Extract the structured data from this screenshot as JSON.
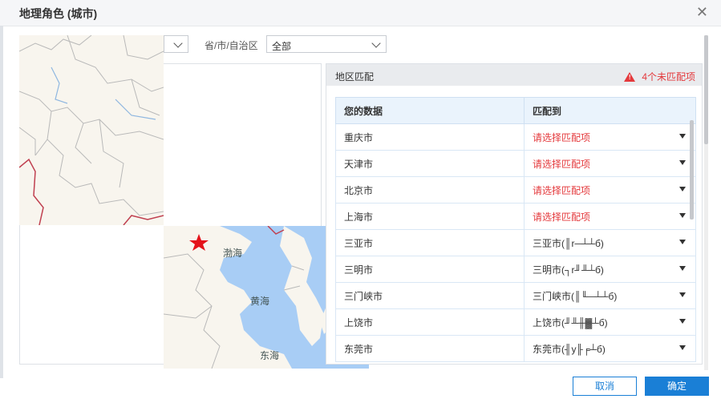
{
  "dialog": {
    "title": "地理角色 (城市)"
  },
  "filters": {
    "province_label": "省/市/自治区",
    "province_value": "全部"
  },
  "map": {
    "seas": [
      "渤海",
      "黄海",
      "东海"
    ]
  },
  "match_panel": {
    "title": "地区匹配",
    "unmatched_warning": "4个未匹配项",
    "columns": [
      "您的数据",
      "匹配到"
    ],
    "rows": [
      {
        "data": "重庆市",
        "match": "请选择匹配项",
        "unmatched": true
      },
      {
        "data": "天津市",
        "match": "请选择匹配项",
        "unmatched": true
      },
      {
        "data": "北京市",
        "match": "请选择匹配项",
        "unmatched": true
      },
      {
        "data": "上海市",
        "match": "请选择匹配项",
        "unmatched": true
      },
      {
        "data": "三亚市",
        "match": "三亚市(║r─┴┴б)",
        "unmatched": false
      },
      {
        "data": "三明市",
        "match": "三明市(┐r╜╨┴б)",
        "unmatched": false
      },
      {
        "data": "三门峡市",
        "match": "三门峡市(║╙─┴┴б)",
        "unmatched": false
      },
      {
        "data": "上饶市",
        "match": "上饶市(╜╨╫▓┴б)",
        "unmatched": false
      },
      {
        "data": "东莞市",
        "match": "东莞市(╢y╟╒┴б)",
        "unmatched": false
      }
    ]
  },
  "buttons": {
    "cancel": "取消",
    "ok": "确定"
  },
  "colors": {
    "accent": "#1a7fd6",
    "warning": "#e4393c",
    "sea": "#a8cdf5"
  }
}
